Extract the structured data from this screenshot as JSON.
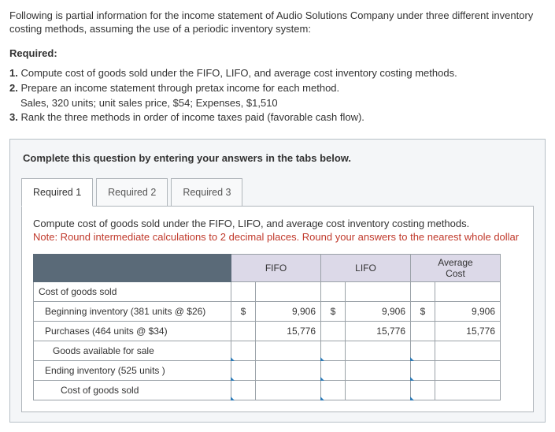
{
  "intro": "Following is partial information for the income statement of Audio Solutions Company under three different inventory costing methods, assuming the use of a periodic inventory system:",
  "required_heading": "Required:",
  "requirements": {
    "r1_num": "1.",
    "r1": "Compute cost of goods sold under the FIFO, LIFO, and average cost inventory costing methods.",
    "r2_num": "2.",
    "r2": "Prepare an income statement through pretax income for each method.",
    "r2_sub": "Sales, 320 units; unit sales price, $54; Expenses, $1,510",
    "r3_num": "3.",
    "r3": "Rank the three methods in order of income taxes paid (favorable cash flow)."
  },
  "banner": "Complete this question by entering your answers in the tabs below.",
  "tabs": {
    "t1": "Required 1",
    "t2": "Required 2",
    "t3": "Required 3"
  },
  "panel": {
    "instruction": "Compute cost of goods sold under the FIFO, LIFO, and average cost inventory costing methods.",
    "note": "Note: Round intermediate calculations to 2 decimal places. Round your answers to the nearest whole dollar"
  },
  "table": {
    "headers": {
      "fifo": "FIFO",
      "lifo": "LIFO",
      "avg1": "Average",
      "avg2": "Cost"
    },
    "rows": {
      "cogs_header": "Cost of goods sold",
      "beg_inv": "Beginning inventory (381 units @ $26)",
      "purchases": "Purchases (464 units @ $34)",
      "gafs": "Goods available for sale",
      "end_inv": "Ending inventory (525 units )",
      "cogs": "Cost of goods sold"
    },
    "values": {
      "cur": "$",
      "beg_fifo": "9,906",
      "beg_lifo": "9,906",
      "beg_avg": "9,906",
      "pur_fifo": "15,776",
      "pur_lifo": "15,776",
      "pur_avg": "15,776"
    }
  }
}
